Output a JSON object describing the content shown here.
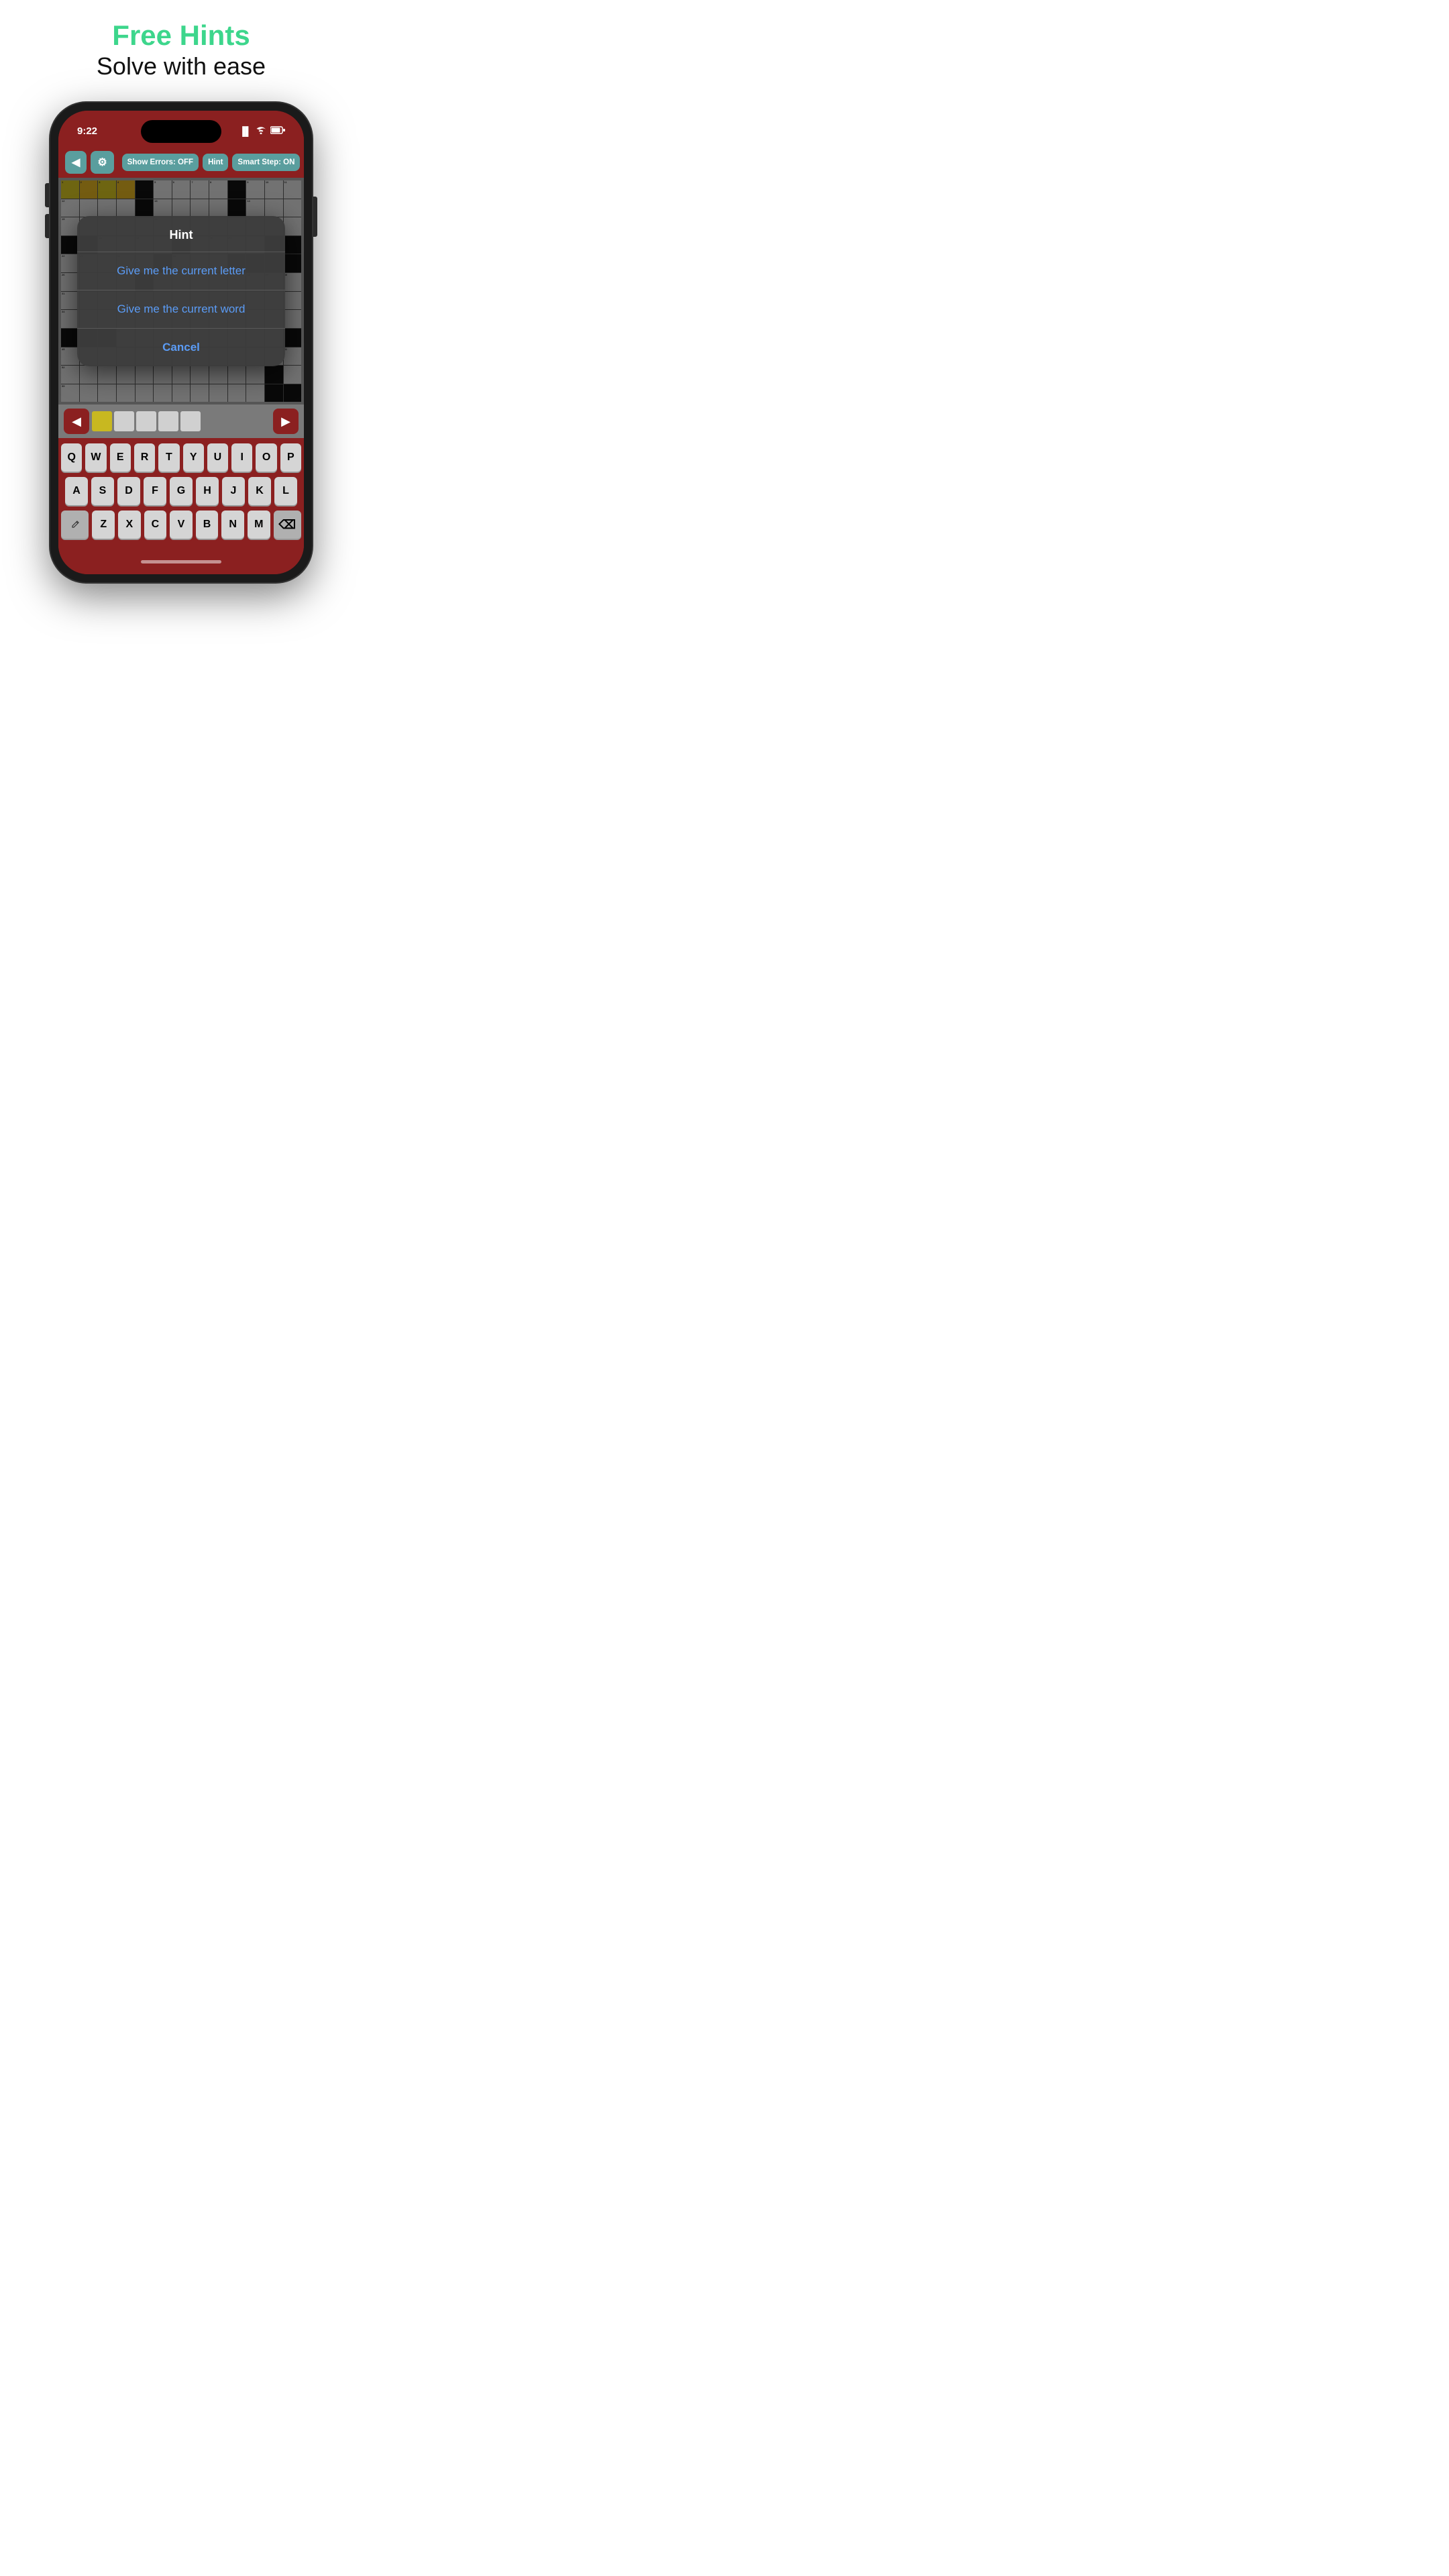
{
  "header": {
    "title": "Free Hints",
    "subtitle": "Solve with ease"
  },
  "status_bar": {
    "time": "9:22"
  },
  "toolbar": {
    "back_label": "◀",
    "settings_label": "⚙",
    "show_errors_label": "Show Errors: OFF",
    "hint_label": "Hint",
    "smart_step_label": "Smart Step: ON"
  },
  "hint_modal": {
    "title": "Hint",
    "option1": "Give me the current letter",
    "option2": "Give me the current word",
    "cancel": "Cancel"
  },
  "keyboard": {
    "row1": [
      "Q",
      "W",
      "E",
      "R",
      "T",
      "Y",
      "U",
      "I",
      "O",
      "P"
    ],
    "row2": [
      "A",
      "S",
      "D",
      "F",
      "G",
      "H",
      "J",
      "K",
      "L"
    ],
    "row3": [
      "Z",
      "X",
      "C",
      "V",
      "B",
      "N",
      "M"
    ]
  }
}
